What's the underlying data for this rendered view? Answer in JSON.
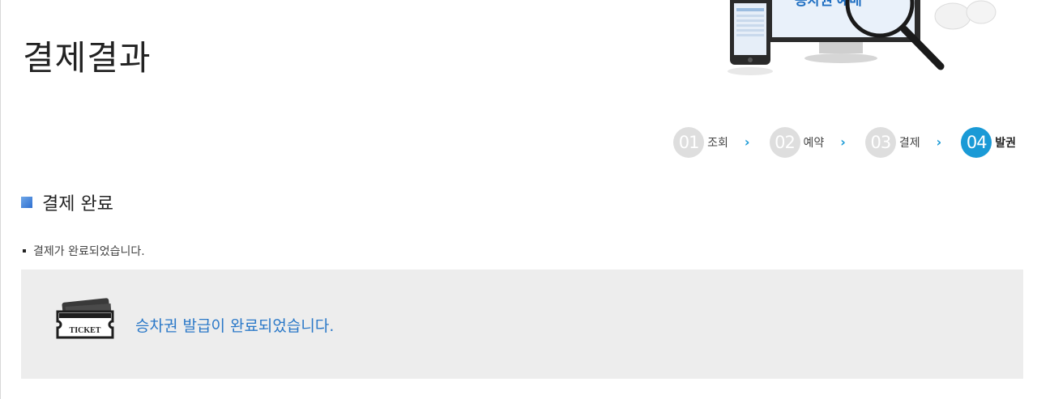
{
  "page": {
    "title": "결제결과",
    "banner_text": "승차권 예매"
  },
  "steps": [
    {
      "num": "01",
      "label": "조회",
      "active": false
    },
    {
      "num": "02",
      "label": "예약",
      "active": false
    },
    {
      "num": "03",
      "label": "결제",
      "active": false
    },
    {
      "num": "04",
      "label": "발권",
      "active": true
    }
  ],
  "section": {
    "title": "결제 완료",
    "notice": "결제가 완료되었습니다."
  },
  "result": {
    "ticket_label": "TICKET",
    "message": "승차권 발급이 완료되었습니다."
  },
  "colors": {
    "accent": "#1a9ad6",
    "message": "#2a78c8",
    "panel": "#ededed"
  }
}
